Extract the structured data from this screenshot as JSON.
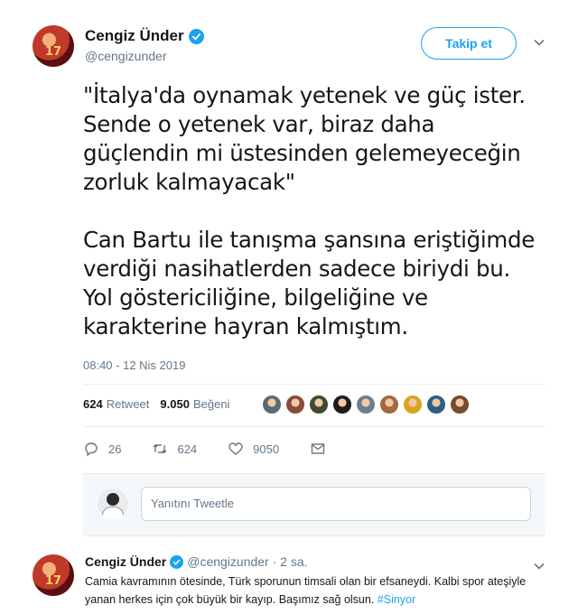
{
  "tweet": {
    "display_name": "Cengiz Ünder",
    "handle": "@cengizunder",
    "avatar_number": "17",
    "follow_label": "Takip et",
    "text": "\"İtalya'da oynamak yetenek ve güç ister.\nSende o yetenek var, biraz daha\ngüçlendin mi üstesinden gelemeyeceğin\nzorluk kalmayacak\"\n\nCan Bartu ile tanışma şansına eriştiğimde\nverdiği nasihatlerden sadece biriydi bu.\nYol göstericiliğine, bilgeliğine ve\nkarakterine hayran kalmıştım.",
    "timestamp": "08:40 - 12 Nis 2019",
    "retweet_count": "624",
    "retweet_label": "Retweet",
    "like_count": "9.050",
    "like_label": "Beğeni",
    "likers": [
      "#5b6b74",
      "#8a4b3a",
      "#3d4b2e",
      "#1c1c1c",
      "#6d7f8c",
      "#a5683f",
      "#d9a520",
      "#2e5e86",
      "#7a4a2c"
    ],
    "actions": {
      "replies": "26",
      "retweets": "624",
      "likes": "9050"
    },
    "reply_placeholder": "Yanıtını Tweetle"
  },
  "reply": {
    "display_name": "Cengiz Ünder",
    "handle_time": "@cengizunder · 2 sa.",
    "avatar_number": "17",
    "text": "Camia kavramının ötesinde, Türk sporunun timsali olan bir efsaneydi. Kalbi spor ateşiyle yanan herkes için çok büyük bir kayıp. Başımız sağ olsun.",
    "hashtag": "#Sinyor"
  },
  "colors": {
    "accent": "#1da1f2",
    "secondary_text": "#657786",
    "border": "#e6ecf0"
  }
}
